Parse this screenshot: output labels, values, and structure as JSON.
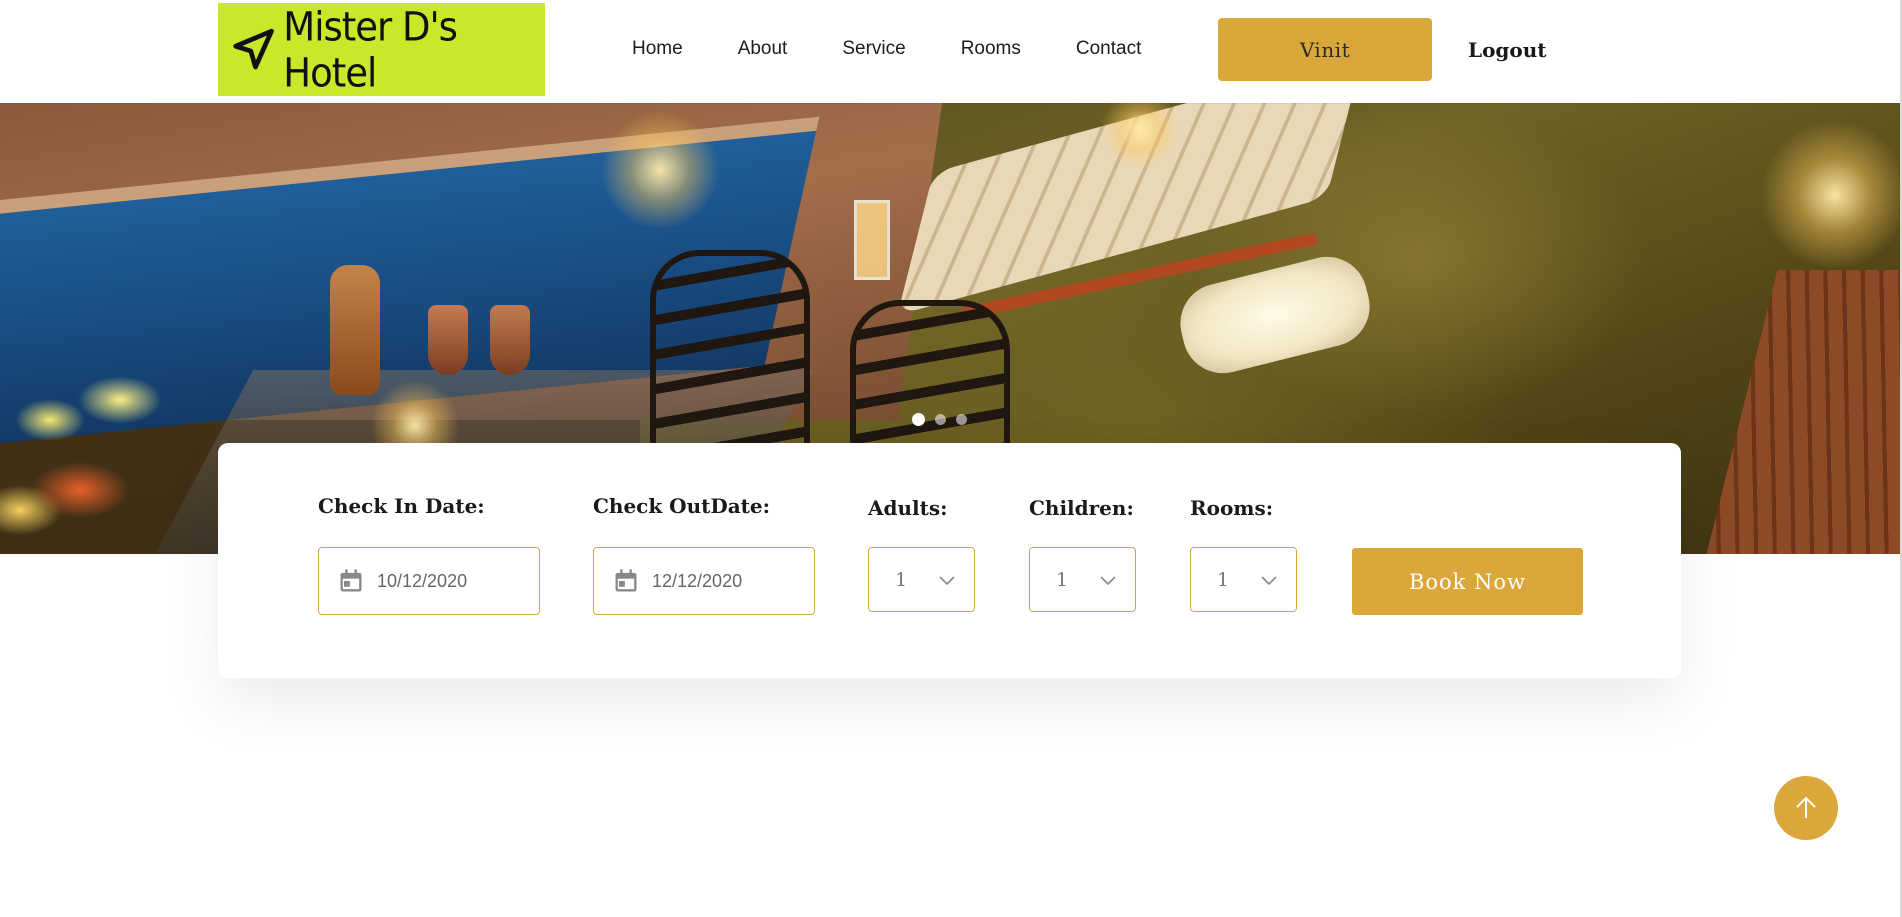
{
  "header": {
    "logo_text": "Mister D's Hotel",
    "logo_bg_color": "#c7e929",
    "nav": [
      "Home",
      "About",
      "Service",
      "Rooms",
      "Contact"
    ],
    "user_button": "Vinit",
    "logout": "Logout"
  },
  "hero": {
    "carousel": {
      "slides": 3,
      "active_index": 0
    }
  },
  "booking": {
    "check_in": {
      "label": "Check In Date:",
      "value": "10/12/2020"
    },
    "check_out": {
      "label": "Check OutDate:",
      "value": "12/12/2020"
    },
    "adults": {
      "label": "Adults:",
      "value": "1"
    },
    "children": {
      "label": "Children:",
      "value": "1"
    },
    "rooms": {
      "label": "Rooms:",
      "value": "1"
    },
    "book_button": "Book Now"
  },
  "icons": [
    "navigation-arrow-icon",
    "calendar-icon",
    "chevron-down-icon",
    "arrow-up-icon"
  ],
  "colors": {
    "accent": "#dba73b",
    "text_dark": "#1a1a1a",
    "input_text": "#666666"
  }
}
